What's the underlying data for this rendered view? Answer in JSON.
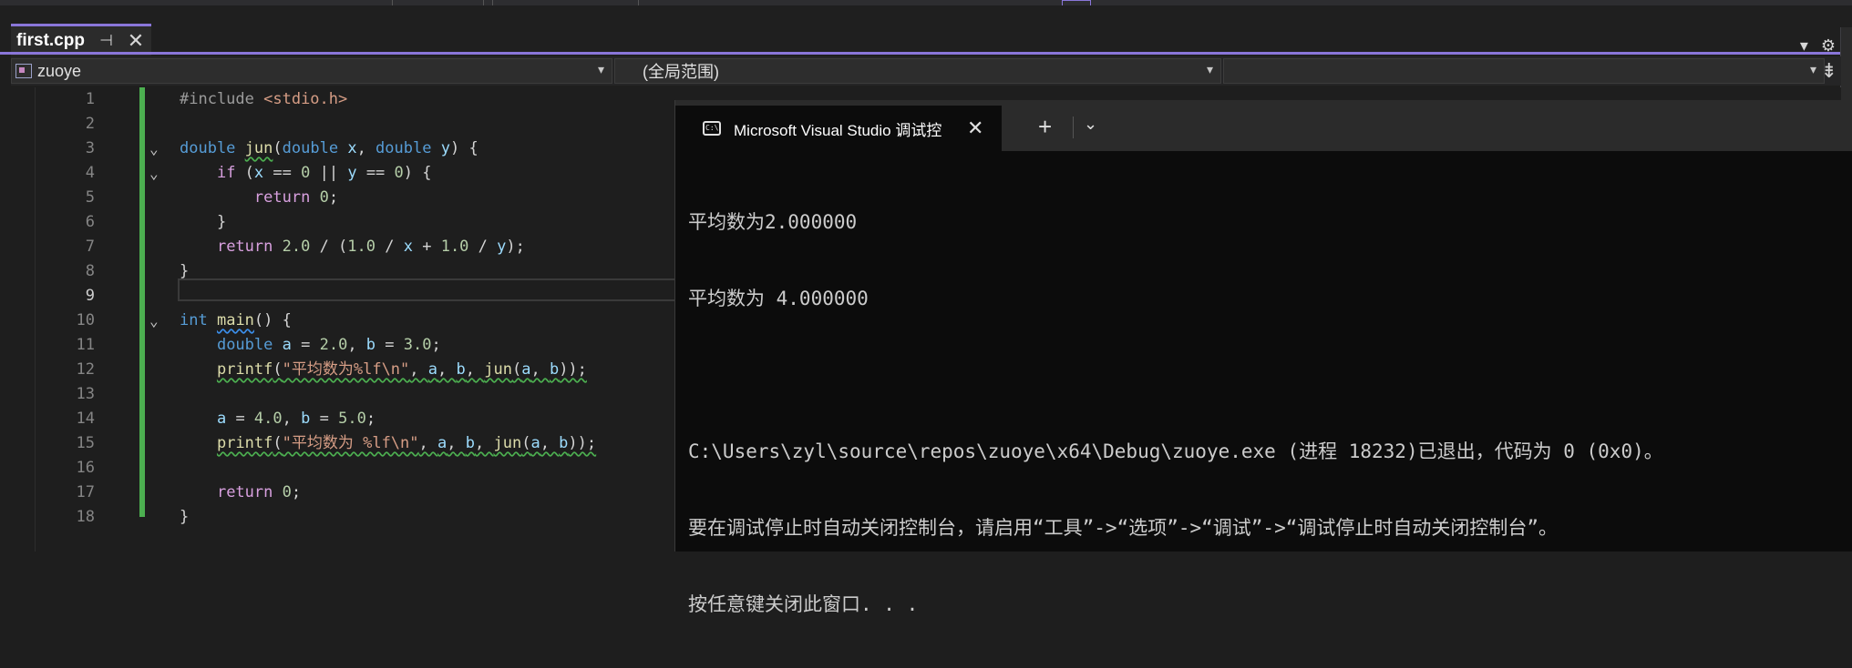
{
  "tab": {
    "title": "first.cpp",
    "pin_icon": "pin-icon",
    "close_label": "✕"
  },
  "tab_tools": {
    "dropdown": "▾",
    "settings": "⚙"
  },
  "navbar": {
    "project": "zuoye",
    "scope": "(全局范围)",
    "member": ""
  },
  "editor": {
    "lines": [
      {
        "n": "1"
      },
      {
        "n": "2"
      },
      {
        "n": "3"
      },
      {
        "n": "4"
      },
      {
        "n": "5"
      },
      {
        "n": "6"
      },
      {
        "n": "7"
      },
      {
        "n": "8"
      },
      {
        "n": "9"
      },
      {
        "n": "10"
      },
      {
        "n": "11"
      },
      {
        "n": "12"
      },
      {
        "n": "13"
      },
      {
        "n": "14"
      },
      {
        "n": "15"
      },
      {
        "n": "16"
      },
      {
        "n": "17"
      },
      {
        "n": "18"
      }
    ],
    "current_line": "9"
  },
  "console": {
    "tab_title": "Microsoft Visual Studio 调试控",
    "output": [
      "平均数为2.000000",
      "平均数为 4.000000",
      "",
      "C:\\Users\\zyl\\source\\repos\\zuoye\\x64\\Debug\\zuoye.exe (进程 18232)已退出，代码为 0 (0x0)。",
      "要在调试停止时自动关闭控制台，请启用“工具”->“选项”->“调试”->“调试停止时自动关闭控制台”。",
      "按任意键关闭此窗口. . ."
    ]
  }
}
